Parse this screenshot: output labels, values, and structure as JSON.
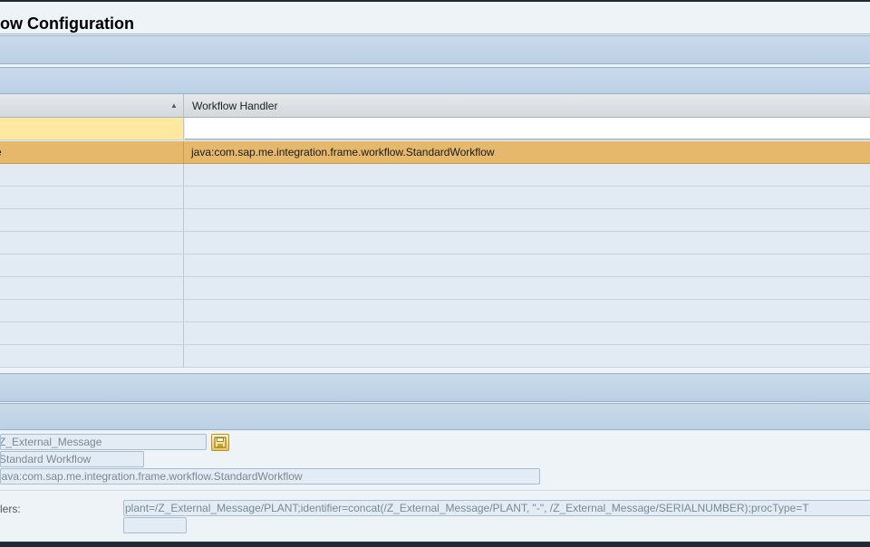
{
  "page": {
    "title": "ow Configuration"
  },
  "grid": {
    "columns": [
      {
        "label": "",
        "sort_icon": "sort-ascending-icon"
      },
      {
        "label": "Workflow Handler"
      }
    ],
    "selected_row": {
      "col1": "e",
      "col2": "java:com.sap.me.integration.frame.workflow.StandardWorkflow"
    },
    "empty_rows": 9
  },
  "form": {
    "message_type": "Z_External_Message",
    "description": "Standard Workflow",
    "handler": "java:com.sap.me.integration.frame.workflow.StandardWorkflow",
    "params_label": "lers:",
    "params_value": "plant=/Z_External_Message/PLANT;identifier=concat(/Z_External_Message/PLANT, \"-\", /Z_External_Message/SERIALNUMBER);procType=T",
    "extra_value": "",
    "save_icon": "save-icon"
  },
  "colors": {
    "selected_row": "#e5b86b",
    "filter_cell": "#ffe8a0",
    "band": "#c3d6e9"
  }
}
